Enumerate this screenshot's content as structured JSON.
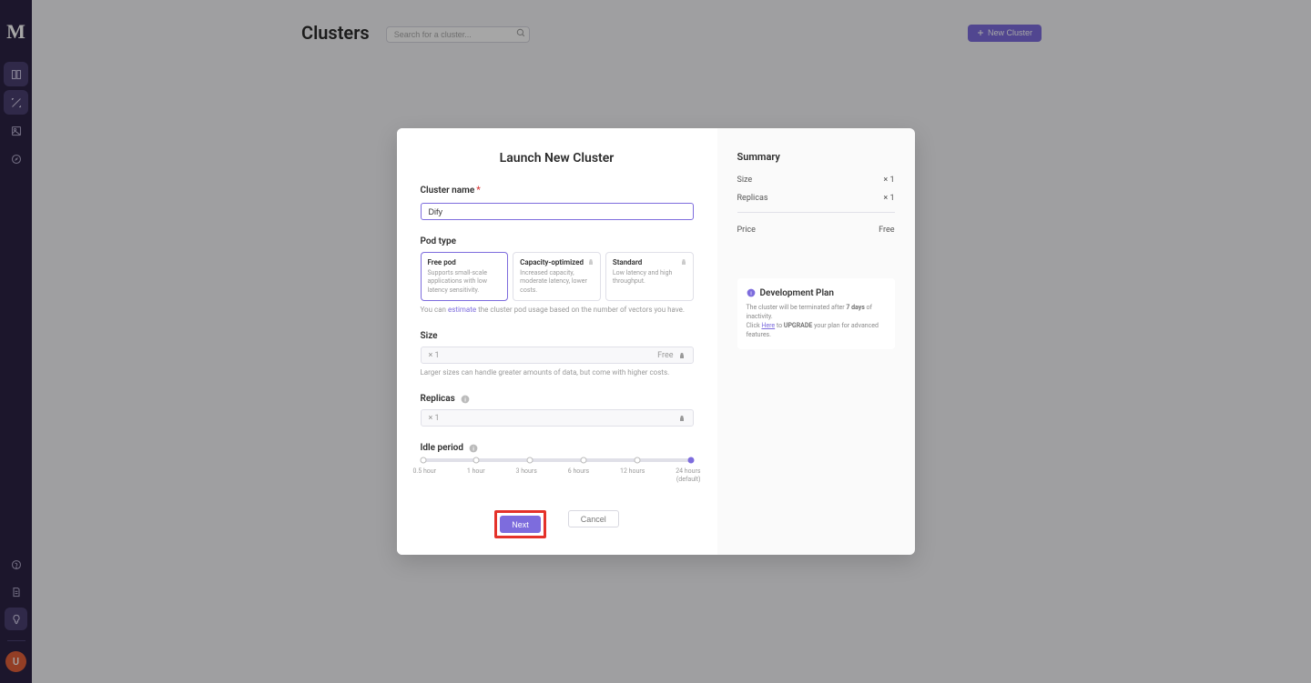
{
  "logo": "M",
  "page_title": "Clusters",
  "search": {
    "placeholder": "Search for a cluster..."
  },
  "new_cluster_btn": "New Cluster",
  "avatar_letter": "U",
  "modal": {
    "title": "Launch New Cluster",
    "cluster_name_label": "Cluster name",
    "cluster_name_value": "Dify",
    "pod_type_label": "Pod type",
    "pods": {
      "free": {
        "title": "Free pod",
        "desc": "Supports small-scale applications with low latency sensitivity."
      },
      "capacity": {
        "title": "Capacity-optimized",
        "desc": "Increased capacity, moderate latency, lower costs."
      },
      "standard": {
        "title": "Standard",
        "desc": "Low latency and high throughput."
      }
    },
    "pod_hint_pre": "You can ",
    "pod_hint_link": "estimate",
    "pod_hint_post": " the cluster pod usage based on the number of vectors you have.",
    "size_label": "Size",
    "size_value": "× 1",
    "size_badge": "Free",
    "size_hint": "Larger sizes can handle greater amounts of data, but come with higher costs.",
    "replicas_label": "Replicas",
    "replicas_value": "× 1",
    "idle_label": "Idle period",
    "idle_ticks": [
      "0.5 hour",
      "1 hour",
      "3 hours",
      "6 hours",
      "12 hours",
      "24 hours"
    ],
    "idle_default": "(default)",
    "next_btn": "Next",
    "cancel_btn": "Cancel"
  },
  "summary": {
    "title": "Summary",
    "size_label": "Size",
    "size_value": "× 1",
    "replicas_label": "Replicas",
    "replicas_value": "× 1",
    "price_label": "Price",
    "price_value": "Free"
  },
  "plan": {
    "title": "Development Plan",
    "line1_pre": "The cluster will be terminated after ",
    "line1_bold": "7 days",
    "line1_post": " of inactivity.",
    "line2_pre": "Click ",
    "line2_link": "Here",
    "line2_mid": " to ",
    "line2_bold": "UPGRADE",
    "line2_post": " your plan for advanced features."
  }
}
